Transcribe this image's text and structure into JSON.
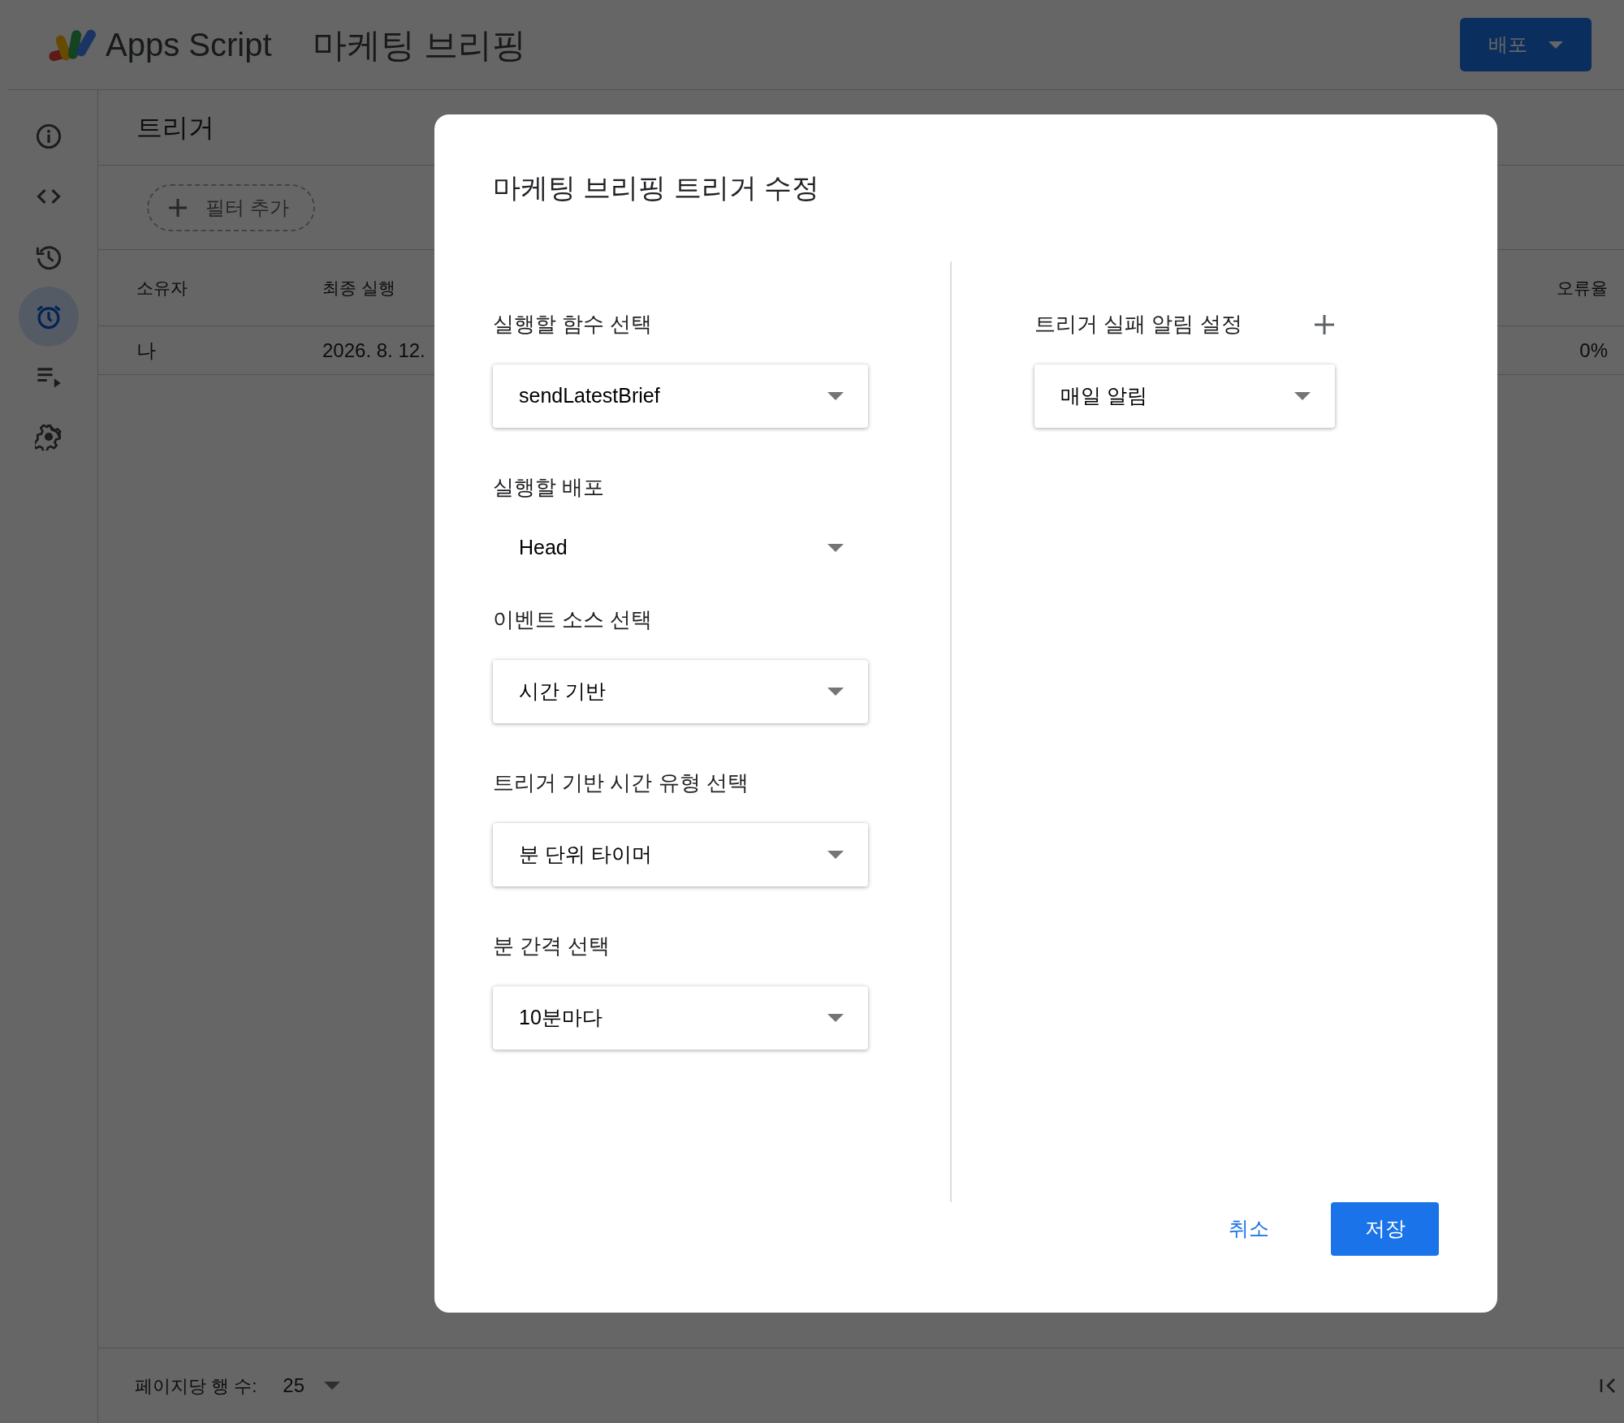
{
  "header": {
    "app_name": "Apps Script",
    "project_title": "마케팅 브리핑",
    "deploy_button": "배포"
  },
  "sidebar": {
    "items": [
      {
        "kind": "info",
        "selected": false
      },
      {
        "kind": "code",
        "selected": false
      },
      {
        "kind": "history",
        "selected": false
      },
      {
        "kind": "alarm",
        "selected": true
      },
      {
        "kind": "playlist",
        "selected": false
      },
      {
        "kind": "gear",
        "selected": false
      }
    ]
  },
  "page": {
    "title": "트리거",
    "filter_chip": "필터 추가",
    "table": {
      "columns": [
        "소유자",
        "최종 실행",
        "오류율"
      ],
      "rows": [
        [
          "나",
          "2026. 8. 12.",
          "0%"
        ]
      ]
    },
    "footer": {
      "rows_per_page_label": "페이지당 행 수:",
      "rows_per_page": "25"
    }
  },
  "dialog": {
    "title": "마케팅 브리핑 트리거 수정",
    "fields": [
      {
        "label": "실행할 함수 선택",
        "value": "sendLatestBrief",
        "kind": "select"
      },
      {
        "label": "실행할 배포",
        "value": "Head",
        "kind": "plain"
      },
      {
        "label": "이벤트 소스 선택",
        "value": "시간 기반",
        "kind": "select"
      },
      {
        "label": "트리거 기반 시간 유형 선택",
        "value": "분 단위 타이머",
        "kind": "select"
      },
      {
        "label": "분 간격 선택",
        "value": "10분마다",
        "kind": "select"
      }
    ],
    "notification": {
      "label": "트리거 실패 알림 설정",
      "value": "매일 알림"
    },
    "cancel_button": "취소",
    "save_button": "저장"
  }
}
